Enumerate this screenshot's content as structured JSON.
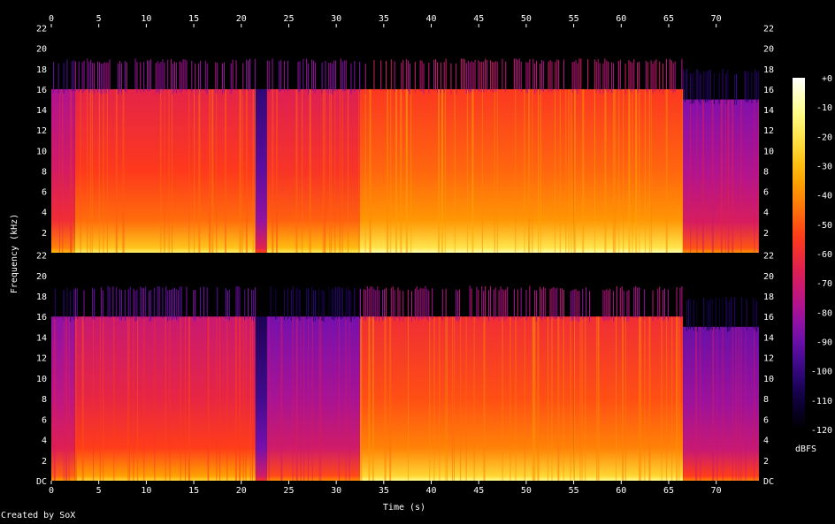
{
  "chart_data": {
    "type": "heatmap",
    "title": "",
    "xlabel": "Time (s)",
    "ylabel": "Frequency (kHz)",
    "colorbar_label": "dBFS",
    "credit": "Created by SoX",
    "xlim": [
      0,
      74.5
    ],
    "ylim_khz": [
      0,
      22.05
    ],
    "x_ticks": [
      {
        "v": 0,
        "label": "0"
      },
      {
        "v": 5,
        "label": "5"
      },
      {
        "v": 10,
        "label": "10"
      },
      {
        "v": 15,
        "label": "15"
      },
      {
        "v": 20,
        "label": "20"
      },
      {
        "v": 25,
        "label": "25"
      },
      {
        "v": 30,
        "label": "30"
      },
      {
        "v": 35,
        "label": "35"
      },
      {
        "v": 40,
        "label": "40"
      },
      {
        "v": 45,
        "label": "45"
      },
      {
        "v": 50,
        "label": "50"
      },
      {
        "v": 55,
        "label": "55"
      },
      {
        "v": 60,
        "label": "60"
      },
      {
        "v": 65,
        "label": "65"
      },
      {
        "v": 70,
        "label": "70"
      }
    ],
    "y_ticks_top": [
      {
        "v": 2,
        "label": "2"
      },
      {
        "v": 4,
        "label": "4"
      },
      {
        "v": 6,
        "label": "6"
      },
      {
        "v": 8,
        "label": "8"
      },
      {
        "v": 10,
        "label": "10"
      },
      {
        "v": 12,
        "label": "12"
      },
      {
        "v": 14,
        "label": "14"
      },
      {
        "v": 16,
        "label": "16"
      },
      {
        "v": 18,
        "label": "18"
      },
      {
        "v": 20,
        "label": "20"
      },
      {
        "v": 22,
        "label": "22"
      }
    ],
    "y_ticks_bottom": [
      {
        "v": 0,
        "label": "DC"
      },
      {
        "v": 2,
        "label": "2"
      },
      {
        "v": 4,
        "label": "4"
      },
      {
        "v": 6,
        "label": "6"
      },
      {
        "v": 8,
        "label": "8"
      },
      {
        "v": 10,
        "label": "10"
      },
      {
        "v": 12,
        "label": "12"
      },
      {
        "v": 14,
        "label": "14"
      },
      {
        "v": 16,
        "label": "16"
      },
      {
        "v": 18,
        "label": "18"
      },
      {
        "v": 20,
        "label": "20"
      },
      {
        "v": 22,
        "label": "22"
      }
    ],
    "colorbar_ticks": [
      {
        "v": 0,
        "label": "+0"
      },
      {
        "v": -10,
        "label": "-10"
      },
      {
        "v": -20,
        "label": "-20"
      },
      {
        "v": -30,
        "label": "-30"
      },
      {
        "v": -40,
        "label": "-40"
      },
      {
        "v": -50,
        "label": "-50"
      },
      {
        "v": -60,
        "label": "-60"
      },
      {
        "v": -70,
        "label": "-70"
      },
      {
        "v": -80,
        "label": "-80"
      },
      {
        "v": -90,
        "label": "-90"
      },
      {
        "v": -100,
        "label": "-100"
      },
      {
        "v": -110,
        "label": "-110"
      },
      {
        "v": -120,
        "label": "-120"
      }
    ],
    "colorbar_range_db": [
      -120,
      0
    ],
    "colormap": [
      "#000000",
      "#100040",
      "#3a0a8a",
      "#7a10b0",
      "#b8148a",
      "#e02050",
      "#ff3a1a",
      "#ff7a08",
      "#ffb000",
      "#ffe040",
      "#ffff90",
      "#ffffff"
    ],
    "channels": [
      {
        "name": "",
        "segments": [
          {
            "t0": 0.0,
            "t1": 2.5,
            "cutoff_khz": 16.0,
            "level_db": -72
          },
          {
            "t0": 2.5,
            "t1": 21.5,
            "cutoff_khz": 16.0,
            "level_db": -58
          },
          {
            "t0": 21.5,
            "t1": 22.7,
            "cutoff_khz": 16.0,
            "level_db": -95
          },
          {
            "t0": 22.7,
            "t1": 32.5,
            "cutoff_khz": 16.0,
            "level_db": -60
          },
          {
            "t0": 32.5,
            "t1": 55.0,
            "cutoff_khz": 16.0,
            "level_db": -50
          },
          {
            "t0": 55.0,
            "t1": 66.5,
            "cutoff_khz": 16.0,
            "level_db": -50
          },
          {
            "t0": 66.5,
            "t1": 74.5,
            "cutoff_khz": 15.0,
            "level_db": -80
          }
        ]
      },
      {
        "name": "",
        "segments": [
          {
            "t0": 0.0,
            "t1": 2.5,
            "cutoff_khz": 16.0,
            "level_db": -78
          },
          {
            "t0": 2.5,
            "t1": 21.5,
            "cutoff_khz": 16.0,
            "level_db": -66
          },
          {
            "t0": 21.5,
            "t1": 22.7,
            "cutoff_khz": 16.0,
            "level_db": -100
          },
          {
            "t0": 22.7,
            "t1": 32.5,
            "cutoff_khz": 16.0,
            "level_db": -82
          },
          {
            "t0": 32.5,
            "t1": 55.0,
            "cutoff_khz": 16.0,
            "level_db": -54
          },
          {
            "t0": 55.0,
            "t1": 66.5,
            "cutoff_khz": 16.0,
            "level_db": -54
          },
          {
            "t0": 66.5,
            "t1": 74.5,
            "cutoff_khz": 15.0,
            "level_db": -84
          }
        ]
      }
    ],
    "grid": false,
    "legend": "colorbar-right"
  }
}
